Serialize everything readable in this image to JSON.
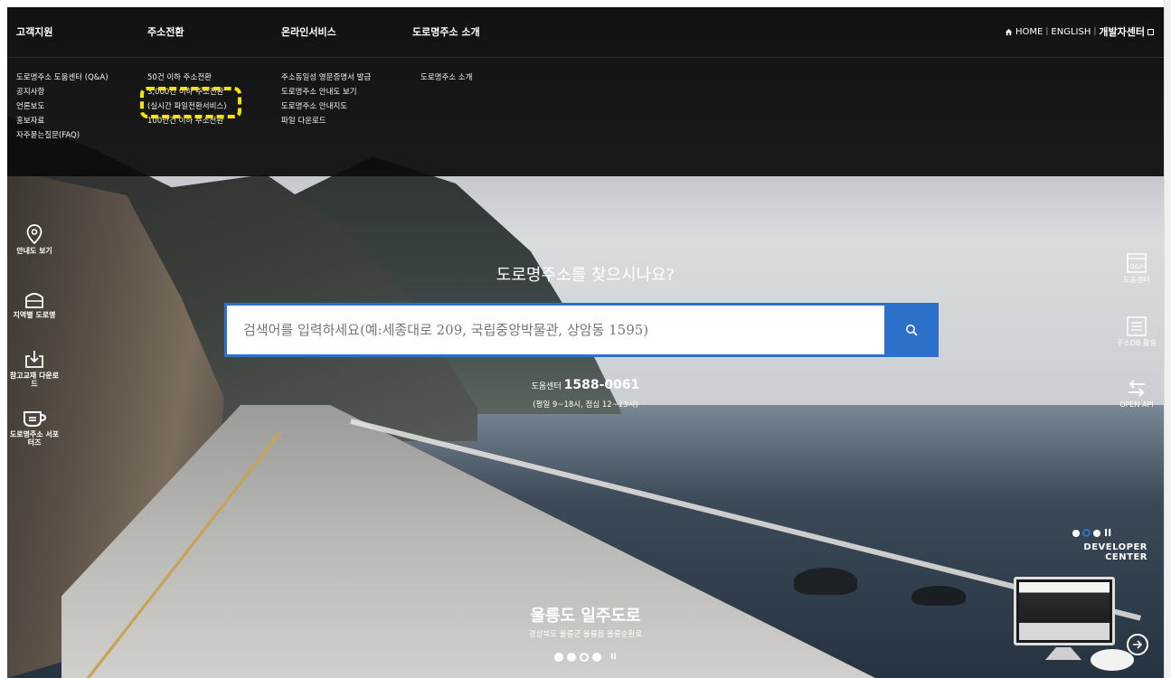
{
  "nav": {
    "main": [
      "고객지원",
      "주소전환",
      "온라인서비스",
      "도로명주소 소개"
    ],
    "util": {
      "home": "HOME",
      "english": "ENGLISH",
      "dev": "개발자센터"
    },
    "submenu": {
      "support": [
        "도로명주소 도움센터 (Q&A)",
        "공지사항",
        "언론보도",
        "홍보자료",
        "자주묻는질문(FAQ)"
      ],
      "convert": [
        "50건 이하 주소전환",
        "3,000건 이하 주소전환",
        "(실시간 파일전환서비스)",
        "100만건 이하 주소전환"
      ],
      "online": [
        "주소동일성 영문증명서 발급",
        "도로명주소 안내도 보기",
        "도로명주소 안내지도",
        "파일 다운로드"
      ],
      "intro": [
        "도로명주소 소개"
      ]
    }
  },
  "left_menu": [
    {
      "label": "안내도 보기",
      "icon": "location-pin-icon"
    },
    {
      "label": "지역별 도로명",
      "icon": "building-icon"
    },
    {
      "label": "참고교재 다운로드",
      "icon": "download-icon"
    },
    {
      "label": "도로명주소 서포터즈",
      "icon": "cup-icon"
    }
  ],
  "right_menu": [
    {
      "label": "도움센터",
      "icon": "qa-window-icon",
      "badge": "Q&A"
    },
    {
      "label": "주소DB 활용",
      "icon": "document-list-icon"
    },
    {
      "label": "OPEN API",
      "icon": "exchange-arrows-icon"
    }
  ],
  "hero": {
    "title": "도로명주소를 찾으시나요?",
    "search_placeholder": "검색어를 입력하세요(예:세종대로 209, 국립중앙박물관, 상암동 1595)",
    "help_prefix": "도움센터",
    "help_phone": "1588-0061",
    "help_hours": "(평일 9~18시, 점심 12~13시)"
  },
  "caption": {
    "title": "울릉도 일주도로",
    "subtitle": "경상북도 울릉군 울릉읍 울릉순환로"
  },
  "developer": {
    "line1": "DEVELOPER",
    "line2": "CENTER"
  },
  "colors": {
    "accent": "#2d70c9",
    "highlight": "#f5e400",
    "nav_bg": "#0c0c0c"
  }
}
